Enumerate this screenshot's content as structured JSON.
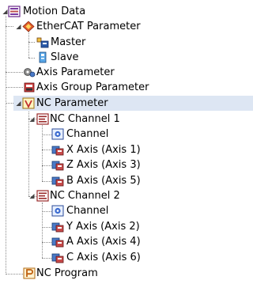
{
  "tree": {
    "root": {
      "label": "Motion Data",
      "icon": "motion-data-icon",
      "children": {
        "ethercat": {
          "label": "EtherCAT Parameter",
          "icon": "ethercat-icon",
          "master": {
            "label": "Master",
            "icon": "master-icon"
          },
          "slave": {
            "label": "Slave",
            "icon": "slave-icon"
          }
        },
        "axis_parameter": {
          "label": "Axis Parameter",
          "icon": "axis-parameter-icon"
        },
        "axis_group_parameter": {
          "label": "Axis Group Parameter",
          "icon": "axis-group-icon"
        },
        "nc_parameter": {
          "label": "NC Parameter",
          "icon": "nc-parameter-icon",
          "selected": true,
          "channel1": {
            "label": "NC Channel 1",
            "icon": "nc-channel-icon",
            "items": [
              {
                "label": "Channel",
                "icon": "channel-icon"
              },
              {
                "label": "X Axis (Axis 1)",
                "icon": "axis-item-icon"
              },
              {
                "label": "Z Axis (Axis 3)",
                "icon": "axis-item-icon"
              },
              {
                "label": "B Axis (Axis 5)",
                "icon": "axis-item-icon"
              }
            ]
          },
          "channel2": {
            "label": "NC Channel 2",
            "icon": "nc-channel-icon",
            "items": [
              {
                "label": "Channel",
                "icon": "channel-icon"
              },
              {
                "label": "Y Axis (Axis 2)",
                "icon": "axis-item-icon"
              },
              {
                "label": "A Axis (Axis 4)",
                "icon": "axis-item-icon"
              },
              {
                "label": "C Axis (Axis 6)",
                "icon": "axis-item-icon"
              }
            ]
          }
        },
        "nc_program": {
          "label": "NC Program",
          "icon": "nc-program-icon"
        }
      }
    },
    "toggle_expanded_glyph": "◢",
    "colors": {
      "selection": "#dde6f3",
      "tree_line": "#8a8a8a"
    }
  }
}
